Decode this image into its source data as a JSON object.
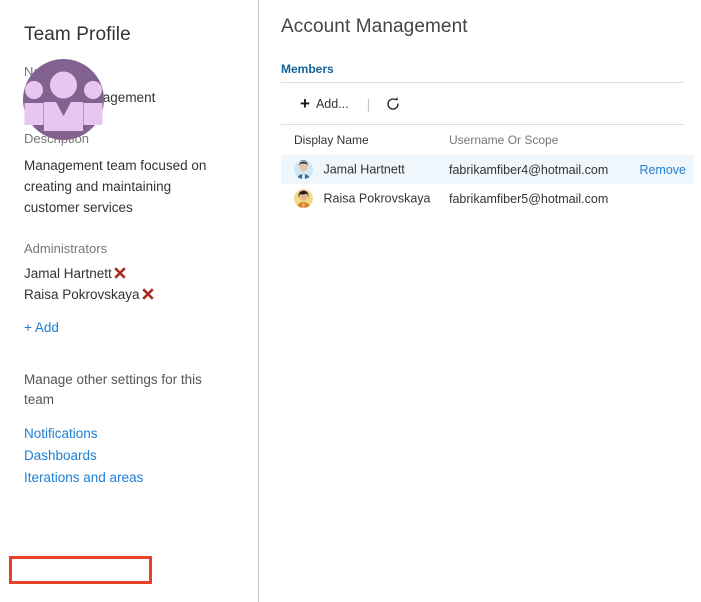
{
  "sidebar": {
    "title": "Team Profile",
    "avatar_icon": "team-group-avatar-icon",
    "name_label": "Name",
    "name_value": "Account Management",
    "description_label": "Description",
    "description_value": "Management team focused on creating and maintaining customer services",
    "administrators_label": "Administrators",
    "administrators": [
      {
        "name": "Jamal Hartnett",
        "remove_icon": "remove-x-icon"
      },
      {
        "name": "Raisa Pokrovskaya",
        "remove_icon": "remove-x-icon"
      }
    ],
    "add_admin_label": "+ Add",
    "manage_text": "Manage other settings for this team",
    "settings_links": [
      {
        "label": "Notifications"
      },
      {
        "label": "Dashboards"
      },
      {
        "label": "Iterations and areas",
        "highlighted": true
      }
    ]
  },
  "main": {
    "title": "Account Management",
    "tabs": [
      {
        "label": "Members",
        "active": true
      }
    ],
    "toolbar": {
      "add_label": "Add...",
      "add_icon": "plus-icon",
      "separator": "|",
      "refresh_icon": "refresh-icon"
    },
    "table": {
      "columns": [
        "Display Name",
        "Username Or Scope",
        ""
      ],
      "rows": [
        {
          "avatar_icon": "user-avatar-blue-icon",
          "display_name": "Jamal Hartnett",
          "username": "fabrikamfiber4@hotmail.com",
          "action": "Remove",
          "selected": true
        },
        {
          "avatar_icon": "user-avatar-yellow-icon",
          "display_name": "Raisa Pokrovskaya",
          "username": "fabrikamfiber5@hotmail.com",
          "action": "",
          "selected": false
        }
      ]
    }
  },
  "colors": {
    "link_blue": "#1e7fd4",
    "tab_blue": "#15639c",
    "avatar_purple_dark": "#826291",
    "avatar_purple_light": "#e8c6f0",
    "remove_x_red": "#a82c22",
    "annotation_red": "#e8412a",
    "row_selected_bg": "#eff6fc"
  }
}
